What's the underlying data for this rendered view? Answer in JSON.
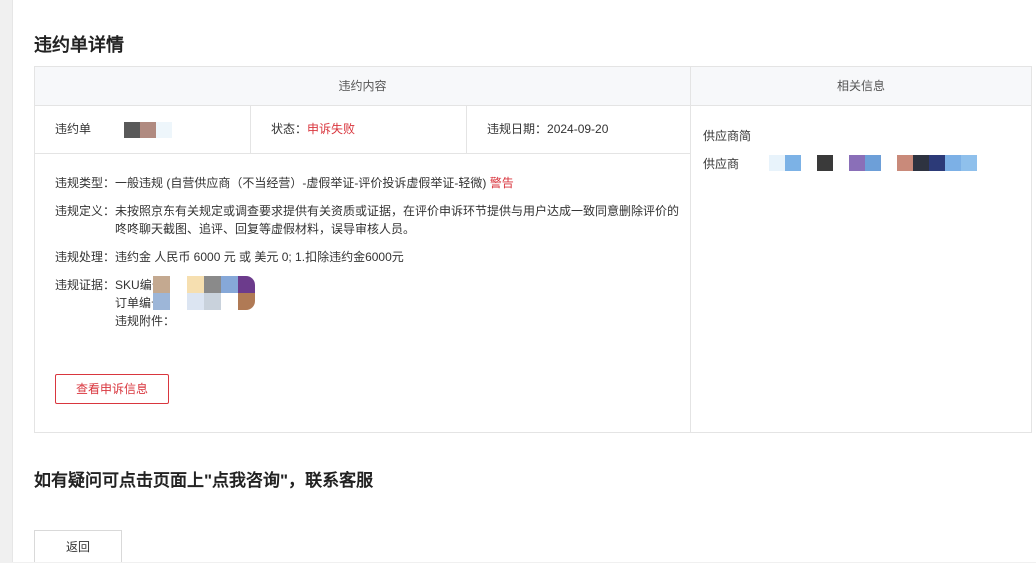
{
  "page": {
    "title": "违约单详情",
    "tip": "如有疑问可点击页面上\"点我咨询\"，联系客服",
    "back_label": "返回"
  },
  "violation": {
    "header": "违约内容",
    "order_label": "违约单",
    "status_label": "状态：",
    "status_value": "申诉失败",
    "date_label": "违规日期：",
    "date_value": "2024-09-20",
    "type_label": "违规类型：",
    "type_value": "一般违规 (自营供应商（不当经营）-虚假举证-评价投诉虚假举证-轻微)",
    "type_badge": "警告",
    "definition_label": "违规定义：",
    "definition_value": "未按照京东有关规定或调查要求提供有关资质或证据，在评价申诉环节提供与用户达成一致同意删除评价的咚咚聊天截图、追评、回复等虚假材料，误导审核人员。",
    "handling_label": "违规处理：",
    "handling_value": "违约金 人民币 6000 元 或 美元 0;  1.扣除违约金6000元",
    "evidence_label": "违规证据：",
    "evidence_items": [
      "SKU编号",
      "订单编号",
      "违规附件："
    ],
    "appeal_button": "查看申诉信息",
    "colors": {
      "accent": "#d9363e"
    }
  },
  "related": {
    "header": "相关信息",
    "supplier_short_label": "供应商简",
    "supplier_label": "供应商"
  }
}
